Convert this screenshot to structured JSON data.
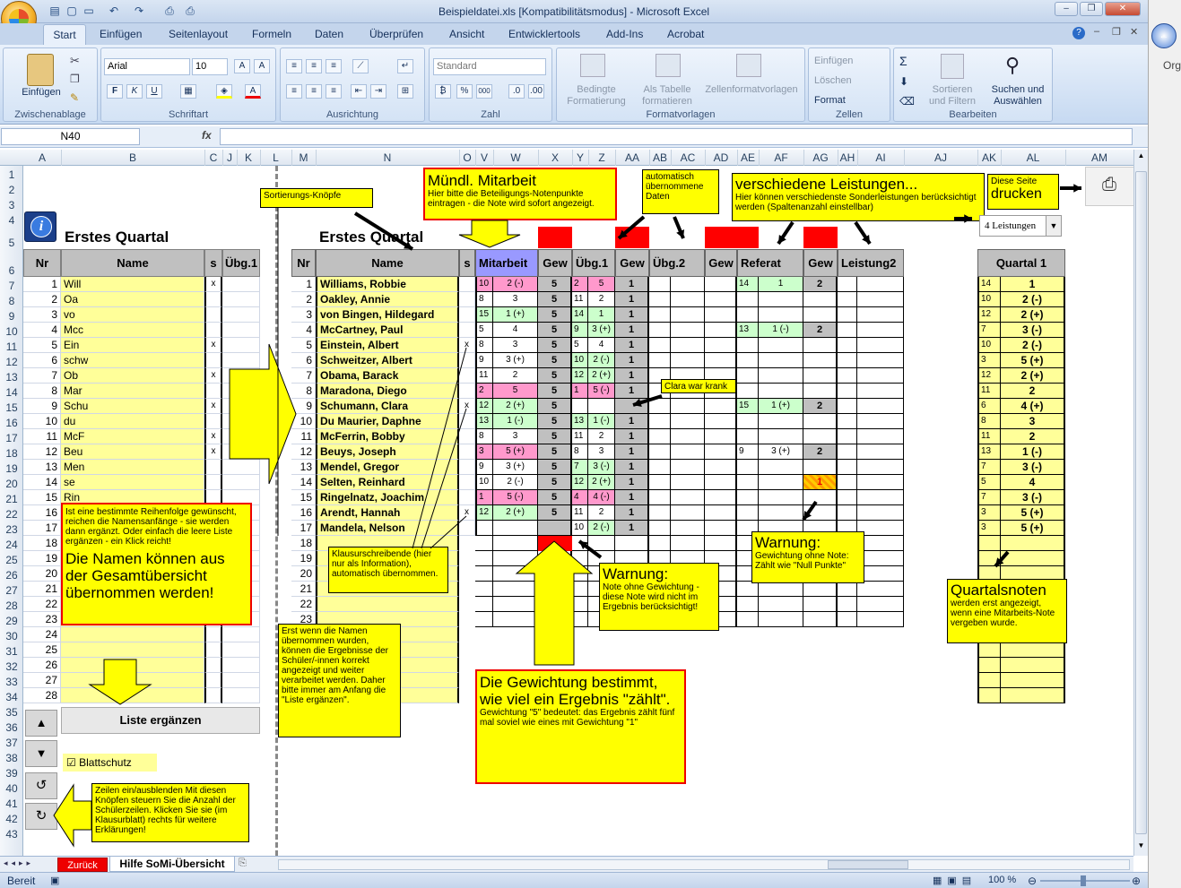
{
  "window": {
    "title": "Beispieldatei.xls  [Kompatibilitätsmodus] - Microsoft Excel",
    "controls": [
      "–",
      "❐",
      "✕"
    ],
    "inner_controls": [
      "–",
      "❐",
      "✕"
    ]
  },
  "ribbon_tabs": [
    "Start",
    "Einfügen",
    "Seitenlayout",
    "Formeln",
    "Daten",
    "Überprüfen",
    "Ansicht",
    "Entwicklertools",
    "Add-Ins",
    "Acrobat"
  ],
  "ribbon": {
    "clipboard": {
      "label": "Zwischenablage",
      "paste": "Einfügen"
    },
    "font": {
      "label": "Schriftart",
      "family": "Arial",
      "size": "10"
    },
    "alignment": {
      "label": "Ausrichtung"
    },
    "number": {
      "label": "Zahl",
      "format": "Standard"
    },
    "styles": {
      "label": "Formatvorlagen",
      "cond": "Bedingte Formatierung",
      "table": "Als Tabelle formatieren",
      "cell": "Zellenformatvorlagen"
    },
    "cells": {
      "label": "Zellen",
      "insert": "Einfügen",
      "delete": "Löschen",
      "format": "Format"
    },
    "editing": {
      "label": "Bearbeiten",
      "sort": "Sortieren und Filtern",
      "find": "Suchen und Auswählen"
    }
  },
  "formula_bar": {
    "name_box": "N40",
    "fx": "fx",
    "value": ""
  },
  "columns": [
    "A",
    "B",
    "C",
    "J",
    "K",
    "L",
    "M",
    "N",
    "O",
    "V",
    "W",
    "X",
    "Y",
    "Z",
    "AA",
    "AB",
    "AC",
    "AD",
    "AE",
    "AF",
    "AG",
    "AH",
    "AI",
    "AJ",
    "AK",
    "AL",
    "AM"
  ],
  "rows": [
    "1",
    "2",
    "3",
    "4",
    "5",
    "6",
    "7",
    "8",
    "9",
    "10",
    "11",
    "12",
    "13",
    "14",
    "15",
    "16",
    "17",
    "18",
    "19",
    "20",
    "21",
    "22",
    "23",
    "24",
    "25",
    "26",
    "27",
    "28",
    "29",
    "30",
    "31",
    "32",
    "33",
    "34",
    "35",
    "36",
    "37",
    "38",
    "39",
    "40",
    "41",
    "42",
    "43"
  ],
  "left_panel": {
    "heading": "Erstes Quartal",
    "headers": {
      "nr": "Nr",
      "name": "Name",
      "s": "s",
      "ubg": "Übg.1"
    },
    "items": [
      {
        "nr": "1",
        "name": "Will",
        "s": "x"
      },
      {
        "nr": "2",
        "name": "Oa",
        "s": ""
      },
      {
        "nr": "3",
        "name": "vo",
        "s": ""
      },
      {
        "nr": "4",
        "name": "Mcc",
        "s": ""
      },
      {
        "nr": "5",
        "name": "Ein",
        "s": "x"
      },
      {
        "nr": "6",
        "name": "schw",
        "s": ""
      },
      {
        "nr": "7",
        "name": "Ob",
        "s": "x"
      },
      {
        "nr": "8",
        "name": "Mar",
        "s": ""
      },
      {
        "nr": "9",
        "name": "Schu",
        "s": "x"
      },
      {
        "nr": "10",
        "name": "du",
        "s": ""
      },
      {
        "nr": "11",
        "name": "McF",
        "s": "x"
      },
      {
        "nr": "12",
        "name": "Beu",
        "s": "x"
      },
      {
        "nr": "13",
        "name": "Men",
        "s": ""
      },
      {
        "nr": "14",
        "name": "se",
        "s": ""
      },
      {
        "nr": "15",
        "name": "Rin",
        "s": ""
      },
      {
        "nr": "16",
        "name": "",
        "s": ""
      },
      {
        "nr": "17",
        "name": "",
        "s": ""
      },
      {
        "nr": "18",
        "name": "",
        "s": ""
      },
      {
        "nr": "19",
        "name": "",
        "s": ""
      },
      {
        "nr": "20",
        "name": "",
        "s": ""
      },
      {
        "nr": "21",
        "name": "",
        "s": ""
      },
      {
        "nr": "22",
        "name": "",
        "s": ""
      },
      {
        "nr": "23",
        "name": "",
        "s": ""
      },
      {
        "nr": "24",
        "name": "",
        "s": ""
      },
      {
        "nr": "25",
        "name": "",
        "s": ""
      },
      {
        "nr": "26",
        "name": "",
        "s": ""
      },
      {
        "nr": "27",
        "name": "",
        "s": ""
      },
      {
        "nr": "28",
        "name": "",
        "s": ""
      }
    ],
    "extend_button": "Liste ergänzen",
    "sheet_protection": "Blattschutz"
  },
  "main": {
    "heading": "Erstes Quartal",
    "headers": {
      "nr": "Nr",
      "name": "Name",
      "s": "s",
      "mitarbeit": "Mitarbeit",
      "gew": "Gew",
      "ubg1": "Übg.1",
      "ubg2": "Übg.2",
      "referat": "Referat",
      "leistung2": "Leistung2",
      "quartal": "Quartal 1"
    },
    "dropdown": "4 Leistungen",
    "students": [
      {
        "nr": "1",
        "name": "Williams, Robbie",
        "s": "",
        "mp": "10",
        "mg": "2 (-)",
        "mw": "5",
        "u1p": "2",
        "u1g": "5",
        "u1w": "1",
        "rp": "14",
        "rg": "1",
        "rw": "2",
        "qp": "14",
        "qg": "1"
      },
      {
        "nr": "2",
        "name": "Oakley, Annie",
        "s": "",
        "mp": "8",
        "mg": "3",
        "mw": "5",
        "u1p": "11",
        "u1g": "2",
        "u1w": "1",
        "rp": "",
        "rg": "",
        "rw": "",
        "qp": "10",
        "qg": "2 (-)"
      },
      {
        "nr": "3",
        "name": "von Bingen, Hildegard",
        "s": "",
        "mp": "15",
        "mg": "1 (+)",
        "mw": "5",
        "u1p": "14",
        "u1g": "1",
        "u1w": "1",
        "rp": "",
        "rg": "",
        "rw": "",
        "qp": "12",
        "qg": "2 (+)"
      },
      {
        "nr": "4",
        "name": "McCartney, Paul",
        "s": "",
        "mp": "5",
        "mg": "4",
        "mw": "5",
        "u1p": "9",
        "u1g": "3 (+)",
        "u1w": "1",
        "rp": "13",
        "rg": "1 (-)",
        "rw": "2",
        "qp": "7",
        "qg": "3 (-)"
      },
      {
        "nr": "5",
        "name": "Einstein, Albert",
        "s": "x",
        "mp": "8",
        "mg": "3",
        "mw": "5",
        "u1p": "5",
        "u1g": "4",
        "u1w": "1",
        "rp": "",
        "rg": "",
        "rw": "",
        "qp": "10",
        "qg": "2 (-)"
      },
      {
        "nr": "6",
        "name": "Schweitzer, Albert",
        "s": "",
        "mp": "9",
        "mg": "3 (+)",
        "mw": "5",
        "u1p": "10",
        "u1g": "2 (-)",
        "u1w": "1",
        "rp": "",
        "rg": "",
        "rw": "",
        "qp": "3",
        "qg": "5 (+)"
      },
      {
        "nr": "7",
        "name": "Obama, Barack",
        "s": "",
        "mp": "11",
        "mg": "2",
        "mw": "5",
        "u1p": "12",
        "u1g": "2 (+)",
        "u1w": "1",
        "rp": "",
        "rg": "",
        "rw": "",
        "qp": "12",
        "qg": "2 (+)"
      },
      {
        "nr": "8",
        "name": "Maradona, Diego",
        "s": "",
        "mp": "2",
        "mg": "5",
        "mw": "5",
        "u1p": "1",
        "u1g": "5 (-)",
        "u1w": "1",
        "rp": "",
        "rg": "",
        "rw": "",
        "qp": "11",
        "qg": "2"
      },
      {
        "nr": "9",
        "name": "Schumann, Clara",
        "s": "x",
        "mp": "12",
        "mg": "2 (+)",
        "mw": "5",
        "u1p": "",
        "u1g": "",
        "u1w": "",
        "rp": "15",
        "rg": "1 (+)",
        "rw": "2",
        "qp": "6",
        "qg": "4 (+)"
      },
      {
        "nr": "10",
        "name": "Du Maurier, Daphne",
        "s": "",
        "mp": "13",
        "mg": "1 (-)",
        "mw": "5",
        "u1p": "13",
        "u1g": "1 (-)",
        "u1w": "1",
        "rp": "",
        "rg": "",
        "rw": "",
        "qp": "8",
        "qg": "3"
      },
      {
        "nr": "11",
        "name": "McFerrin, Bobby",
        "s": "",
        "mp": "8",
        "mg": "3",
        "mw": "5",
        "u1p": "11",
        "u1g": "2",
        "u1w": "1",
        "rp": "",
        "rg": "",
        "rw": "",
        "qp": "11",
        "qg": "2"
      },
      {
        "nr": "12",
        "name": "Beuys, Joseph",
        "s": "",
        "mp": "3",
        "mg": "5 (+)",
        "mw": "5",
        "u1p": "8",
        "u1g": "3",
        "u1w": "1",
        "rp": "9",
        "rg": "3 (+)",
        "rw": "2",
        "qp": "13",
        "qg": "1 (-)"
      },
      {
        "nr": "13",
        "name": "Mendel, Gregor",
        "s": "",
        "mp": "9",
        "mg": "3 (+)",
        "mw": "5",
        "u1p": "7",
        "u1g": "3 (-)",
        "u1w": "1",
        "rp": "",
        "rg": "",
        "rw": "",
        "qp": "7",
        "qg": "3 (-)"
      },
      {
        "nr": "14",
        "name": "Selten, Reinhard",
        "s": "",
        "mp": "10",
        "mg": "2 (-)",
        "mw": "5",
        "u1p": "12",
        "u1g": "2 (+)",
        "u1w": "1",
        "rp": "",
        "rg": "",
        "rw": "1",
        "qp": "5",
        "qg": "4"
      },
      {
        "nr": "15",
        "name": "Ringelnatz, Joachim",
        "s": "",
        "mp": "1",
        "mg": "5 (-)",
        "mw": "5",
        "u1p": "4",
        "u1g": "4 (-)",
        "u1w": "1",
        "rp": "",
        "rg": "",
        "rw": "",
        "qp": "7",
        "qg": "3 (-)"
      },
      {
        "nr": "16",
        "name": "Arendt, Hannah",
        "s": "x",
        "mp": "12",
        "mg": "2 (+)",
        "mw": "5",
        "u1p": "11",
        "u1g": "2",
        "u1w": "1",
        "rp": "",
        "rg": "",
        "rw": "",
        "qp": "3",
        "qg": "5 (+)"
      },
      {
        "nr": "17",
        "name": "Mandela, Nelson",
        "s": "",
        "mp": "",
        "mg": "",
        "mw": "",
        "u1p": "10",
        "u1g": "2 (-)",
        "u1w": "1",
        "rp": "",
        "rg": "",
        "rw": "",
        "qp": "3",
        "qg": "5 (+)"
      }
    ],
    "empty_rows": [
      "18",
      "19",
      "20",
      "21",
      "22",
      "23"
    ]
  },
  "notes": {
    "sort": "Sortierungs-Knöpfe",
    "muendl_title": "Mündl. Mitarbeit",
    "muendl_text": "Hier bitte die Beteiligungs-Notenpunkte eintragen - die Note wird sofort angezeigt.",
    "auto": "automatisch übernommene Daten",
    "versch_title": "verschiedene Leistungen...",
    "versch_text": "Hier können verschiedenste Sonderleistungen berücksichtigt werden (Spaltenanzahl einstellbar)",
    "drucken_small": "Diese Seite",
    "drucken_big": "drucken",
    "clara": "Clara war krank",
    "names_small": "Ist eine bestimmte Reihenfolge gewünscht, reichen die Namensanfänge - sie werden dann ergänzt. Oder einfach die leere Liste ergänzen - ein Klick reicht!",
    "names_big": "Die Namen können aus der Gesamtübersicht übernommen werden!",
    "klausur": "Klausurschreibende (hier nur als Information), automatisch übernommen.",
    "warn1_title": "Warnung:",
    "warn1_text": "Note ohne Gewichtung - diese Note wird nicht im Ergebnis berücksichtigt!",
    "warn2_title": "Warnung:",
    "warn2_text": "Gewichtung ohne Note: Zählt wie \"Null Punkte\"",
    "quartal_title": "Quartalsnoten",
    "quartal_text": "werden erst angezeigt, wenn eine Mitarbeits-Note vergeben wurde.",
    "erst": "Erst wenn die Namen übernommen wurden, können die Ergebnisse der Schüler/-innen korrekt angezeigt und weiter verarbeitet werden. Daher bitte immer am Anfang die \"Liste ergänzen\".",
    "gew_title": "Die Gewichtung bestimmt, wie viel ein Ergebnis \"zählt\".",
    "gew_text": "Gewichtung \"5\" bedeutet: das Ergebnis zählt fünf mal soviel wie eines mit Gewichtung \"1\"",
    "zeilen": "Zeilen ein/ausblenden Mit diesen Knöpfen steuern Sie die Anzahl der Schülerzeilen. Klicken Sie sie (im Klausurblatt) rechts für weitere Erklärungen!"
  },
  "warn_cell": "1",
  "sheet_tabs": {
    "tab1": "Zurück",
    "tab2": "Hilfe SoMi-Übersicht"
  },
  "status": {
    "ready": "Bereit",
    "zoom": "100 %"
  },
  "right_pane": {
    "text": "Org"
  },
  "colors": {
    "yellow": "#ffff00",
    "lightyellow": "#ffff99",
    "red": "#ff0000",
    "pink": "#ff99cc",
    "green": "#ccffcc",
    "purple": "#9999ff",
    "gray": "#c0c0c0"
  }
}
